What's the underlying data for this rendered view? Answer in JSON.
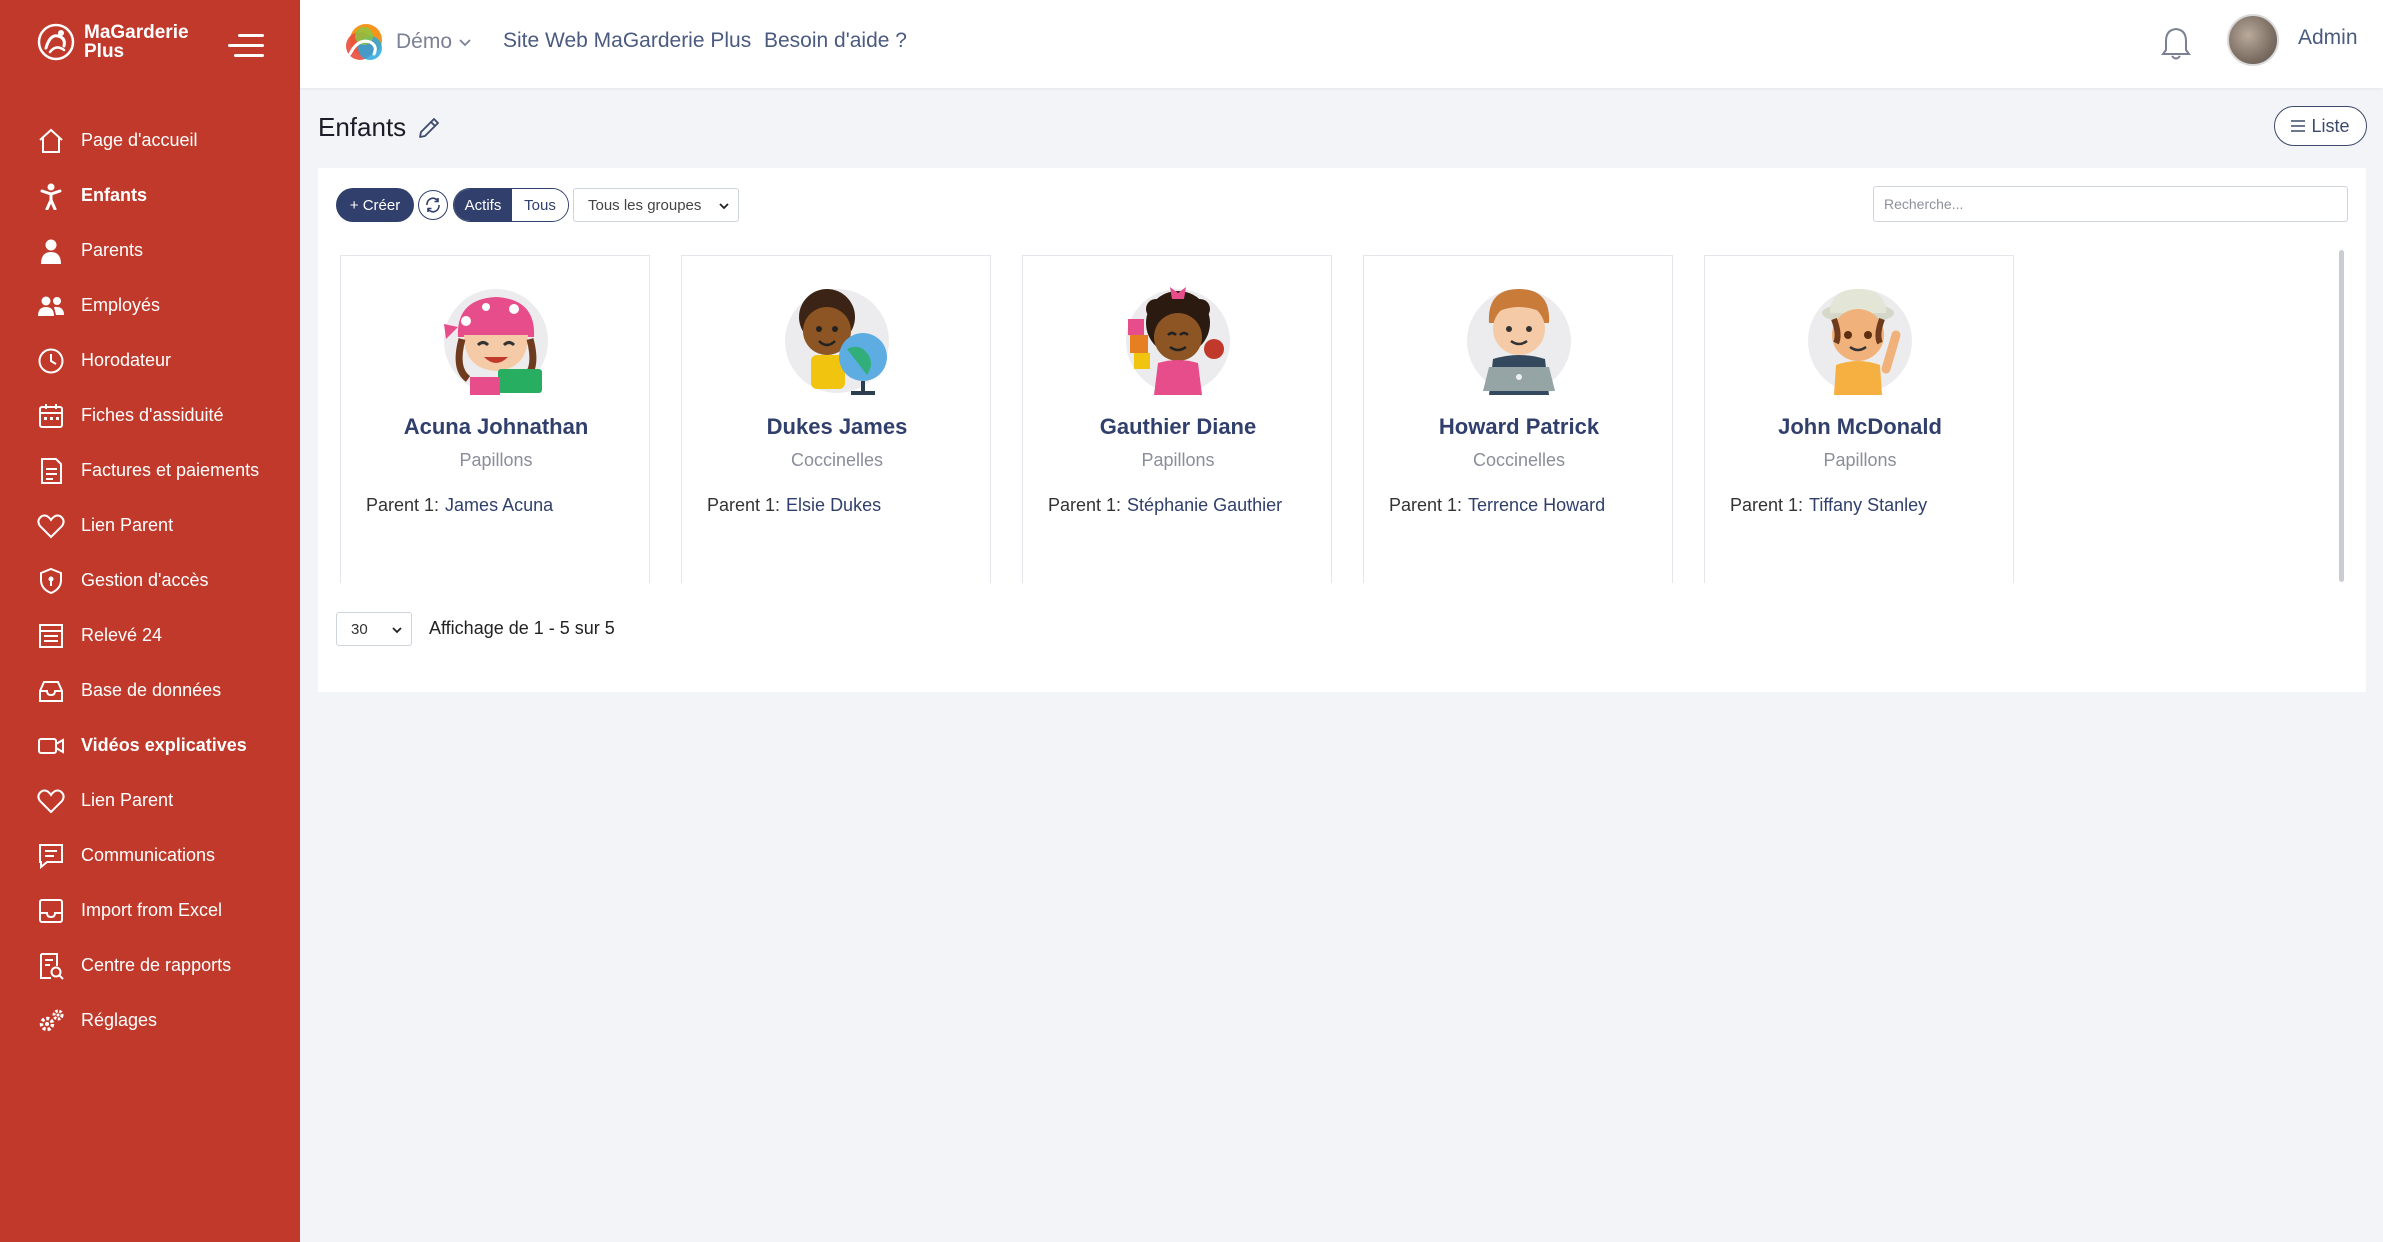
{
  "brand": {
    "name": "MaGarderie Plus",
    "accent": "#c0392b",
    "primary": "#303f6b"
  },
  "sidebar": {
    "items": [
      {
        "label": "Page d'accueil",
        "icon": "home-icon"
      },
      {
        "label": "Enfants",
        "icon": "child-icon"
      },
      {
        "label": "Parents",
        "icon": "parent-icon"
      },
      {
        "label": "Employés",
        "icon": "employees-icon"
      },
      {
        "label": "Horodateur",
        "icon": "clock-icon"
      },
      {
        "label": "Fiches d'assiduité",
        "icon": "calendar-icon"
      },
      {
        "label": "Factures et paiements",
        "icon": "invoice-icon"
      },
      {
        "label": "Lien Parent",
        "icon": "heart-icon"
      },
      {
        "label": "Gestion d'accès",
        "icon": "shield-icon"
      },
      {
        "label": "Relevé 24",
        "icon": "statement-icon"
      },
      {
        "label": "Base de données",
        "icon": "database-icon"
      },
      {
        "label": "Vidéos explicatives",
        "icon": "video-icon"
      },
      {
        "label": "Lien Parent",
        "icon": "heart-icon"
      },
      {
        "label": "Communications",
        "icon": "message-icon"
      },
      {
        "label": "Import from Excel",
        "icon": "inbox-icon"
      },
      {
        "label": "Centre de rapports",
        "icon": "report-icon"
      },
      {
        "label": "Réglages",
        "icon": "gears-icon"
      }
    ]
  },
  "topbar": {
    "demo": "Démo",
    "links": [
      "Site Web MaGarderie Plus",
      "Besoin d'aide ?"
    ],
    "user": "Admin"
  },
  "page": {
    "title": "Enfants",
    "view_button": "Liste"
  },
  "toolbar": {
    "create": "+ Créer",
    "active": "Actifs",
    "all": "Tous",
    "group_select": "Tous les groupes",
    "search_placeholder": "Recherche..."
  },
  "children": [
    {
      "name": "Acuna Johnathan",
      "group": "Papillons",
      "parent_label": "Parent 1:",
      "parent": "James Acuna"
    },
    {
      "name": "Dukes James",
      "group": "Coccinelles",
      "parent_label": "Parent 1:",
      "parent": "Elsie Dukes"
    },
    {
      "name": "Gauthier Diane",
      "group": "Papillons",
      "parent_label": "Parent 1:",
      "parent": "Stéphanie Gauthier"
    },
    {
      "name": "Howard Patrick",
      "group": "Coccinelles",
      "parent_label": "Parent 1:",
      "parent": "Terrence Howard"
    },
    {
      "name": "John McDonald",
      "group": "Papillons",
      "parent_label": "Parent 1:",
      "parent": "Tiffany Stanley"
    }
  ],
  "pagination": {
    "per_page": "30",
    "showing": "Affichage de 1 - 5 sur 5"
  }
}
